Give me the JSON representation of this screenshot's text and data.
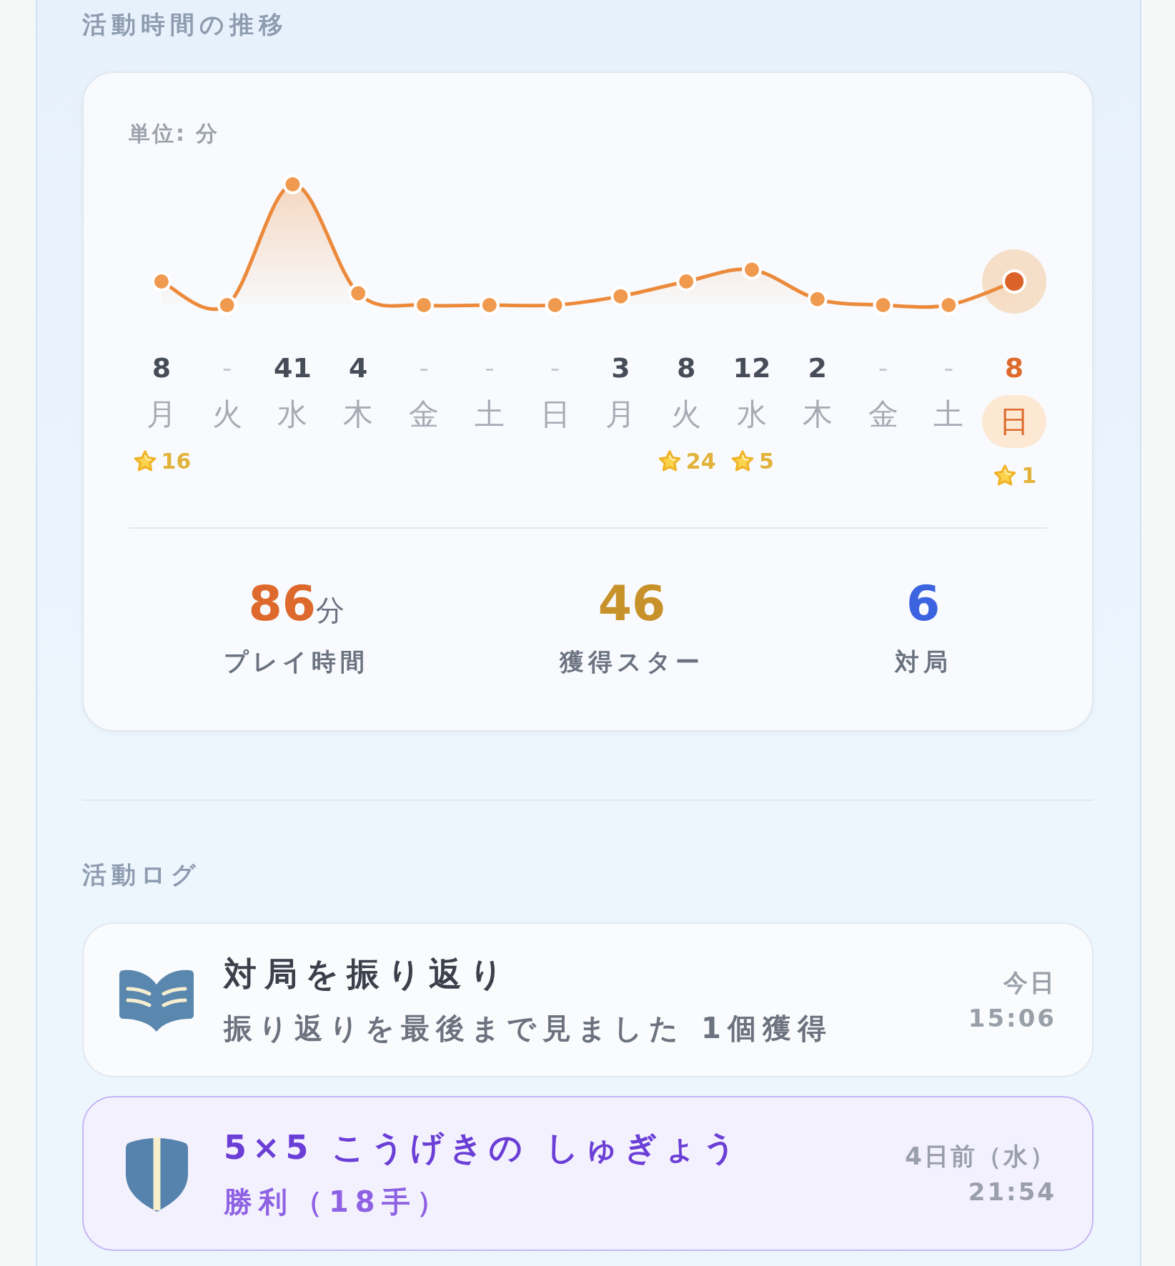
{
  "trend": {
    "title": "活動時間の推移",
    "chart_card": {
      "unit_label": "単位: 分",
      "chart_data": {
        "type": "area",
        "marker": "circle",
        "categories": [
          "月",
          "火",
          "水",
          "木",
          "金",
          "土",
          "日",
          "月",
          "火",
          "水",
          "木",
          "金",
          "土",
          "日"
        ],
        "values": [
          8,
          0,
          41,
          4,
          0,
          0,
          0,
          3,
          8,
          12,
          2,
          0,
          0,
          8
        ],
        "data_labels": true,
        "value_labels": [
          "8",
          "-",
          "41",
          "4",
          "-",
          "-",
          "-",
          "3",
          "8",
          "12",
          "2",
          "-",
          "-",
          "8"
        ]
      },
      "columns": [
        {
          "today": false,
          "star_reward": "16"
        },
        {
          "today": false
        },
        {
          "today": false
        },
        {
          "today": false
        },
        {
          "today": false
        },
        {
          "today": false
        },
        {
          "today": false
        },
        {
          "today": false
        },
        {
          "today": false,
          "star_reward": "24"
        },
        {
          "today": false,
          "star_reward": "5"
        },
        {
          "today": false
        },
        {
          "today": false
        },
        {
          "today": false
        },
        {
          "today": true,
          "star_reward": "1"
        }
      ],
      "stats": [
        {
          "kind": "time",
          "value": "86",
          "unit": "分",
          "label": "プレイ時間"
        },
        {
          "kind": "stars",
          "value": "46",
          "label": "獲得スター"
        },
        {
          "kind": "games",
          "value": "6",
          "label": "対局"
        }
      ]
    }
  },
  "log": {
    "title": "活動ログ",
    "entries": [
      {
        "kind": "review",
        "title": "対局を振り返り",
        "detail": "振り返りを最後まで見ました 1個獲得",
        "when": "今日",
        "time": "15:06"
      },
      {
        "kind": "match",
        "title": "5×5 こうげきの しゅぎょう",
        "detail": "勝利（18手）",
        "when": "4日前（水）",
        "time": "21:54"
      }
    ]
  }
}
